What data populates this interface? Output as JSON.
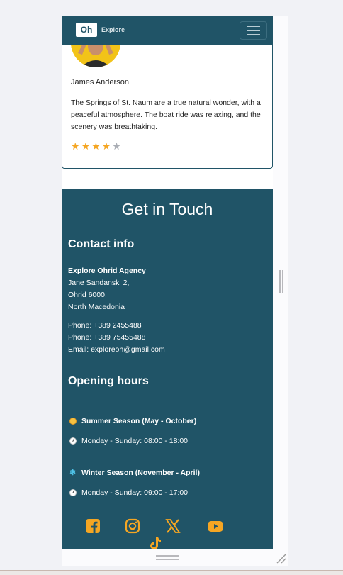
{
  "navbar": {
    "logo_mark": "Oh",
    "logo_text": "Explore",
    "menu_icon": "hamburger-menu-icon"
  },
  "testimonial": {
    "name": "James Anderson",
    "text": "The Springs of St. Naum are a true natural wonder, with a peaceful atmosphere. The boat ride was relaxing, and the scenery was breathtaking.",
    "rating": 4,
    "max_rating": 5,
    "colors": {
      "star_on": "#f5a623",
      "star_off": "#a9adb4"
    }
  },
  "contact": {
    "title": "Get in Touch",
    "info_heading": "Contact info",
    "agency_name": "Explore Ohrid Agency",
    "address_line1": "Jane Sandanski 2,",
    "address_line2": "Ohrid 6000,",
    "address_line3": "North Macedonia",
    "phone1": "Phone: +389 2455488",
    "phone2": "Phone: +389 75455488",
    "email": "Email: exploreoh@gmail.com",
    "hours_heading": "Opening hours",
    "summer_label": "Summer Season (May - October)",
    "summer_hours": "Monday - Sunday: 08:00 - 18:00",
    "winter_label": "Winter Season (November - April)",
    "winter_hours": "Monday - Sunday: 09:00 - 17:00"
  },
  "social": [
    "facebook-icon",
    "instagram-icon",
    "x-icon",
    "youtube-icon",
    "tiktok-icon"
  ],
  "colors": {
    "brand": "#205467",
    "accent": "#f5a623"
  }
}
